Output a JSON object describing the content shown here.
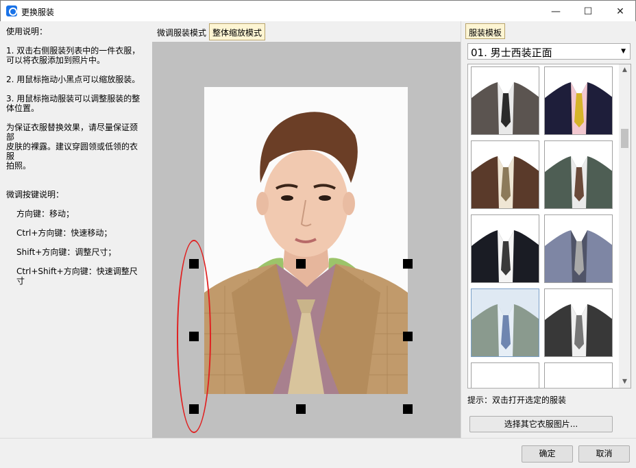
{
  "window": {
    "title": "更换服装",
    "minimize_glyph": "—",
    "maximize_glyph": "☐",
    "close_glyph": "✕"
  },
  "instructions": {
    "heading": "使用说明：",
    "step1_line1": "1. 双击右侧服装列表中的一件衣服，",
    "step1_line2": "可以将衣服添加到照片中。",
    "step2": "2. 用鼠标拖动小黑点可以缩放服装。",
    "step3_line1": "3. 用鼠标拖动服装可以调整服装的整",
    "step3_line2": "体位置。",
    "tip_line1": "为保证衣服替换效果，请尽量保证颈部",
    "tip_line2": "皮肤的裸露。建议穿圆领或低领的衣服",
    "tip_line3": "拍照。",
    "keys_heading": "微调按键说明：",
    "key1": "方向键：移动；",
    "key2": "Ctrl+方向键：快速移动；",
    "key3": "Shift+方向键：调整尺寸；",
    "key4": "Ctrl+Shift+方向键：快速调整尺寸"
  },
  "mode_tabs": {
    "fine": "微调服装模式",
    "whole": "整体缩放模式"
  },
  "templates": {
    "tab": "服装模板",
    "selected": "01. 男士西装正面",
    "hint": "提示：双击打开选定的服装",
    "choose_button": "选择其它衣服图片..."
  },
  "footer": {
    "ok": "确定",
    "cancel": "取消"
  },
  "colors": {
    "selection_ellipse": "#e02020",
    "tab_active_bg": "#fdf5d3"
  }
}
